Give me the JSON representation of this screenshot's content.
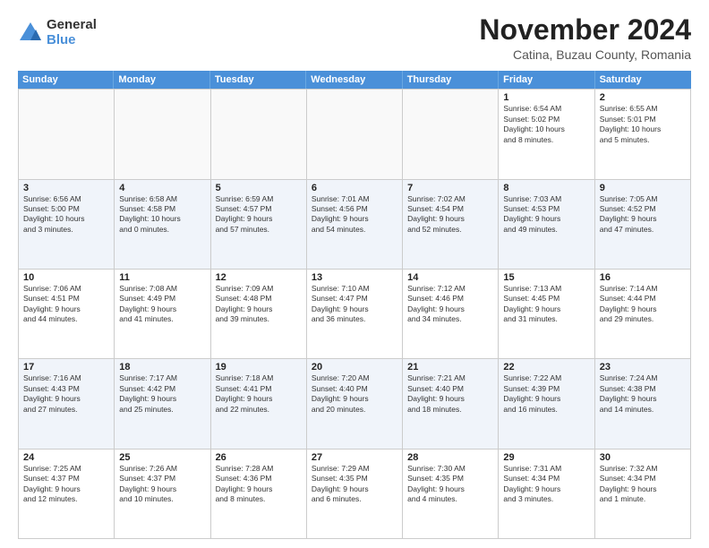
{
  "logo": {
    "general": "General",
    "blue": "Blue"
  },
  "title": "November 2024",
  "subtitle": "Catina, Buzau County, Romania",
  "calendar": {
    "headers": [
      "Sunday",
      "Monday",
      "Tuesday",
      "Wednesday",
      "Thursday",
      "Friday",
      "Saturday"
    ],
    "rows": [
      [
        {
          "day": "",
          "info": ""
        },
        {
          "day": "",
          "info": ""
        },
        {
          "day": "",
          "info": ""
        },
        {
          "day": "",
          "info": ""
        },
        {
          "day": "",
          "info": ""
        },
        {
          "day": "1",
          "info": "Sunrise: 6:54 AM\nSunset: 5:02 PM\nDaylight: 10 hours\nand 8 minutes."
        },
        {
          "day": "2",
          "info": "Sunrise: 6:55 AM\nSunset: 5:01 PM\nDaylight: 10 hours\nand 5 minutes."
        }
      ],
      [
        {
          "day": "3",
          "info": "Sunrise: 6:56 AM\nSunset: 5:00 PM\nDaylight: 10 hours\nand 3 minutes."
        },
        {
          "day": "4",
          "info": "Sunrise: 6:58 AM\nSunset: 4:58 PM\nDaylight: 10 hours\nand 0 minutes."
        },
        {
          "day": "5",
          "info": "Sunrise: 6:59 AM\nSunset: 4:57 PM\nDaylight: 9 hours\nand 57 minutes."
        },
        {
          "day": "6",
          "info": "Sunrise: 7:01 AM\nSunset: 4:56 PM\nDaylight: 9 hours\nand 54 minutes."
        },
        {
          "day": "7",
          "info": "Sunrise: 7:02 AM\nSunset: 4:54 PM\nDaylight: 9 hours\nand 52 minutes."
        },
        {
          "day": "8",
          "info": "Sunrise: 7:03 AM\nSunset: 4:53 PM\nDaylight: 9 hours\nand 49 minutes."
        },
        {
          "day": "9",
          "info": "Sunrise: 7:05 AM\nSunset: 4:52 PM\nDaylight: 9 hours\nand 47 minutes."
        }
      ],
      [
        {
          "day": "10",
          "info": "Sunrise: 7:06 AM\nSunset: 4:51 PM\nDaylight: 9 hours\nand 44 minutes."
        },
        {
          "day": "11",
          "info": "Sunrise: 7:08 AM\nSunset: 4:49 PM\nDaylight: 9 hours\nand 41 minutes."
        },
        {
          "day": "12",
          "info": "Sunrise: 7:09 AM\nSunset: 4:48 PM\nDaylight: 9 hours\nand 39 minutes."
        },
        {
          "day": "13",
          "info": "Sunrise: 7:10 AM\nSunset: 4:47 PM\nDaylight: 9 hours\nand 36 minutes."
        },
        {
          "day": "14",
          "info": "Sunrise: 7:12 AM\nSunset: 4:46 PM\nDaylight: 9 hours\nand 34 minutes."
        },
        {
          "day": "15",
          "info": "Sunrise: 7:13 AM\nSunset: 4:45 PM\nDaylight: 9 hours\nand 31 minutes."
        },
        {
          "day": "16",
          "info": "Sunrise: 7:14 AM\nSunset: 4:44 PM\nDaylight: 9 hours\nand 29 minutes."
        }
      ],
      [
        {
          "day": "17",
          "info": "Sunrise: 7:16 AM\nSunset: 4:43 PM\nDaylight: 9 hours\nand 27 minutes."
        },
        {
          "day": "18",
          "info": "Sunrise: 7:17 AM\nSunset: 4:42 PM\nDaylight: 9 hours\nand 25 minutes."
        },
        {
          "day": "19",
          "info": "Sunrise: 7:18 AM\nSunset: 4:41 PM\nDaylight: 9 hours\nand 22 minutes."
        },
        {
          "day": "20",
          "info": "Sunrise: 7:20 AM\nSunset: 4:40 PM\nDaylight: 9 hours\nand 20 minutes."
        },
        {
          "day": "21",
          "info": "Sunrise: 7:21 AM\nSunset: 4:40 PM\nDaylight: 9 hours\nand 18 minutes."
        },
        {
          "day": "22",
          "info": "Sunrise: 7:22 AM\nSunset: 4:39 PM\nDaylight: 9 hours\nand 16 minutes."
        },
        {
          "day": "23",
          "info": "Sunrise: 7:24 AM\nSunset: 4:38 PM\nDaylight: 9 hours\nand 14 minutes."
        }
      ],
      [
        {
          "day": "24",
          "info": "Sunrise: 7:25 AM\nSunset: 4:37 PM\nDaylight: 9 hours\nand 12 minutes."
        },
        {
          "day": "25",
          "info": "Sunrise: 7:26 AM\nSunset: 4:37 PM\nDaylight: 9 hours\nand 10 minutes."
        },
        {
          "day": "26",
          "info": "Sunrise: 7:28 AM\nSunset: 4:36 PM\nDaylight: 9 hours\nand 8 minutes."
        },
        {
          "day": "27",
          "info": "Sunrise: 7:29 AM\nSunset: 4:35 PM\nDaylight: 9 hours\nand 6 minutes."
        },
        {
          "day": "28",
          "info": "Sunrise: 7:30 AM\nSunset: 4:35 PM\nDaylight: 9 hours\nand 4 minutes."
        },
        {
          "day": "29",
          "info": "Sunrise: 7:31 AM\nSunset: 4:34 PM\nDaylight: 9 hours\nand 3 minutes."
        },
        {
          "day": "30",
          "info": "Sunrise: 7:32 AM\nSunset: 4:34 PM\nDaylight: 9 hours\nand 1 minute."
        }
      ]
    ]
  }
}
